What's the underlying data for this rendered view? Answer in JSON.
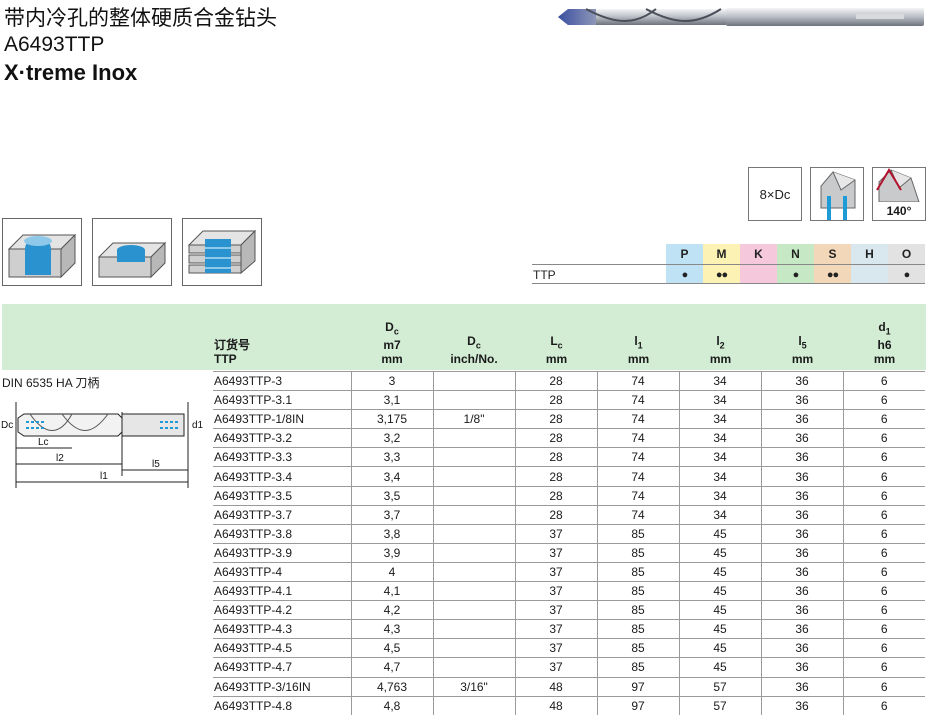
{
  "title": {
    "cn": "带内冷孔的整体硬质合金钻头",
    "code": "A6493TTP",
    "series": "X·treme Inox"
  },
  "spec_icons": {
    "depth_label": "8×Dc",
    "angle_label": "140°"
  },
  "application_icons": [
    "blind-hole-icon",
    "through-hole-icon",
    "stacked-plates-icon"
  ],
  "materials": {
    "row_label": "TTP",
    "groups": [
      {
        "code": "P",
        "color": "#bfe3f5",
        "rating": "●"
      },
      {
        "code": "M",
        "color": "#fbf2b3",
        "rating": "●●"
      },
      {
        "code": "K",
        "color": "#f6c8dc",
        "rating": ""
      },
      {
        "code": "N",
        "color": "#c6e8c4",
        "rating": "●"
      },
      {
        "code": "S",
        "color": "#f2d7b8",
        "rating": "●●"
      },
      {
        "code": "H",
        "color": "#d9e8ef",
        "rating": ""
      },
      {
        "code": "O",
        "color": "#e2e2e2",
        "rating": "●"
      }
    ]
  },
  "table_header": {
    "order_no": [
      "订货号",
      "TTP"
    ],
    "dc": [
      "Dc",
      "m7",
      "mm"
    ],
    "dc_inch": [
      "Dc",
      "inch/No."
    ],
    "lc": [
      "Lc",
      "mm"
    ],
    "l1": [
      "l1",
      "mm"
    ],
    "l2": [
      "l2",
      "mm"
    ],
    "l5": [
      "l5",
      "mm"
    ],
    "d1": [
      "d1",
      "h6",
      "mm"
    ]
  },
  "din_label": "DIN 6535 HA 刀柄",
  "diagram_labels": {
    "dc": "Dc",
    "lc": "Lc",
    "l2": "l2",
    "l5": "l5",
    "l1": "l1",
    "d1": "d1"
  },
  "rows": [
    [
      "A6493TTP-3",
      "3",
      "",
      "28",
      "74",
      "34",
      "36",
      "6"
    ],
    [
      "A6493TTP-3.1",
      "3,1",
      "",
      "28",
      "74",
      "34",
      "36",
      "6"
    ],
    [
      "A6493TTP-1/8IN",
      "3,175",
      "1/8\"",
      "28",
      "74",
      "34",
      "36",
      "6"
    ],
    [
      "A6493TTP-3.2",
      "3,2",
      "",
      "28",
      "74",
      "34",
      "36",
      "6"
    ],
    [
      "A6493TTP-3.3",
      "3,3",
      "",
      "28",
      "74",
      "34",
      "36",
      "6"
    ],
    [
      "A6493TTP-3.4",
      "3,4",
      "",
      "28",
      "74",
      "34",
      "36",
      "6"
    ],
    [
      "A6493TTP-3.5",
      "3,5",
      "",
      "28",
      "74",
      "34",
      "36",
      "6"
    ],
    [
      "A6493TTP-3.7",
      "3,7",
      "",
      "28",
      "74",
      "34",
      "36",
      "6"
    ],
    [
      "A6493TTP-3.8",
      "3,8",
      "",
      "37",
      "85",
      "45",
      "36",
      "6"
    ],
    [
      "A6493TTP-3.9",
      "3,9",
      "",
      "37",
      "85",
      "45",
      "36",
      "6"
    ],
    [
      "A6493TTP-4",
      "4",
      "",
      "37",
      "85",
      "45",
      "36",
      "6"
    ],
    [
      "A6493TTP-4.1",
      "4,1",
      "",
      "37",
      "85",
      "45",
      "36",
      "6"
    ],
    [
      "A6493TTP-4.2",
      "4,2",
      "",
      "37",
      "85",
      "45",
      "36",
      "6"
    ],
    [
      "A6493TTP-4.3",
      "4,3",
      "",
      "37",
      "85",
      "45",
      "36",
      "6"
    ],
    [
      "A6493TTP-4.5",
      "4,5",
      "",
      "37",
      "85",
      "45",
      "36",
      "6"
    ],
    [
      "A6493TTP-4.7",
      "4,7",
      "",
      "37",
      "85",
      "45",
      "36",
      "6"
    ],
    [
      "A6493TTP-3/16IN",
      "4,763",
      "3/16\"",
      "48",
      "97",
      "57",
      "36",
      "6"
    ],
    [
      "A6493TTP-4.8",
      "4,8",
      "",
      "48",
      "97",
      "57",
      "36",
      "6"
    ]
  ]
}
